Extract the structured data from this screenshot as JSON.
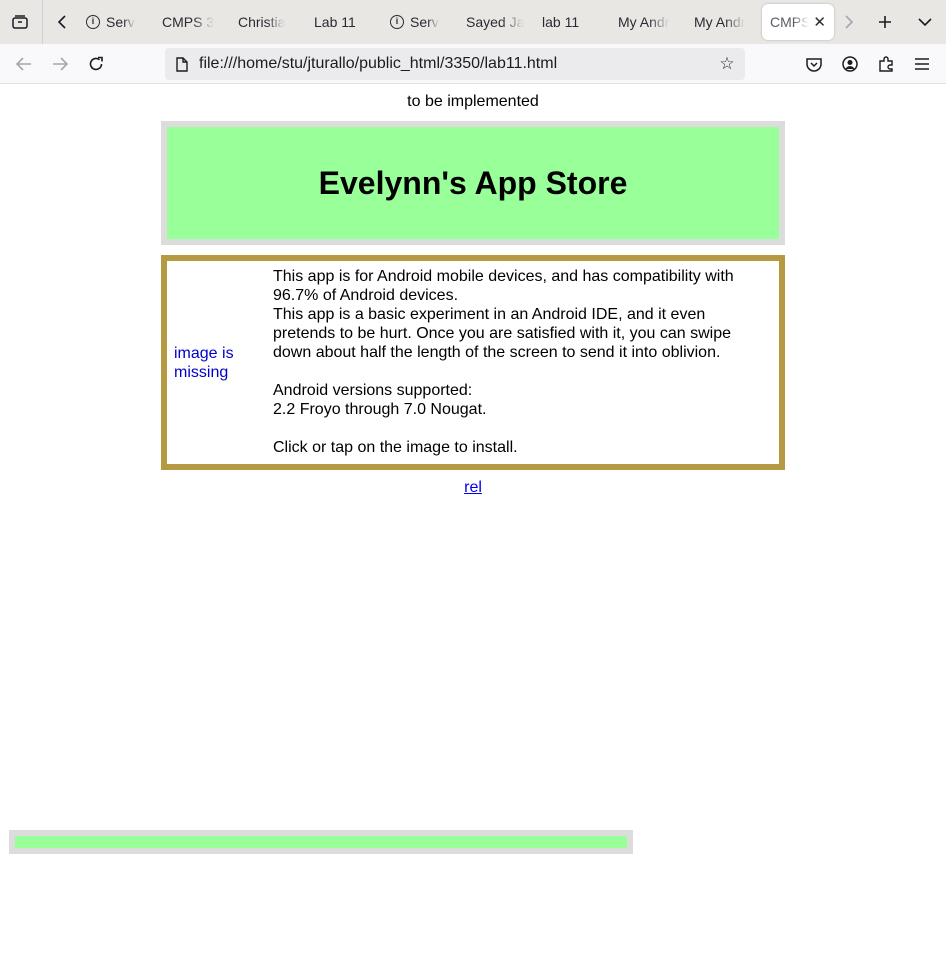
{
  "tabs": [
    {
      "label": "Serv",
      "has_info_icon": true
    },
    {
      "label": "CMPS 3"
    },
    {
      "label": "Christia"
    },
    {
      "label": "Lab 11"
    },
    {
      "label": "Serv",
      "has_info_icon": true
    },
    {
      "label": "Sayed Ja"
    },
    {
      "label": "lab 11"
    },
    {
      "label": "My Andr"
    },
    {
      "label": "My Andr"
    },
    {
      "label": "CMPS 3",
      "active": true
    }
  ],
  "navbar": {
    "url": "file:///home/stu/jturallo/public_html/3350/lab11.html"
  },
  "page": {
    "impl_note": "to be implemented",
    "store_title": "Evelynn's App Store",
    "image_alt": "image is missing",
    "desc_line1": "This app is for Android mobile devices, and has compatibility with 96.7% of Android devices.",
    "desc_line2": "This app is a basic experiment in an Android IDE, and it even pretends to be hurt. Once you are satisfied with it, you can swipe down about half the length of the screen to send it into oblivion.",
    "versions_label": "Android versions supported:",
    "versions_value": "2.2 Froyo through 7.0 Nougat.",
    "install_hint": "Click or tap on the image to install.",
    "rel_link": "rel",
    "progress": 1.0
  },
  "colors": {
    "header_green": "#99ff99",
    "frame_gray": "#dcdcdc",
    "app_border_gold": "#b59a43",
    "link_blue": "#0000ee"
  },
  "icons": [
    "tab-overview-icon",
    "back-icon",
    "forward-icon",
    "reload-icon",
    "page-icon",
    "star-icon",
    "pocket-icon",
    "account-icon",
    "extensions-icon",
    "menu-icon",
    "new-tab-icon",
    "list-all-tabs-icon",
    "close-icon",
    "info-icon",
    "chevron-left-icon",
    "chevron-right-icon"
  ]
}
